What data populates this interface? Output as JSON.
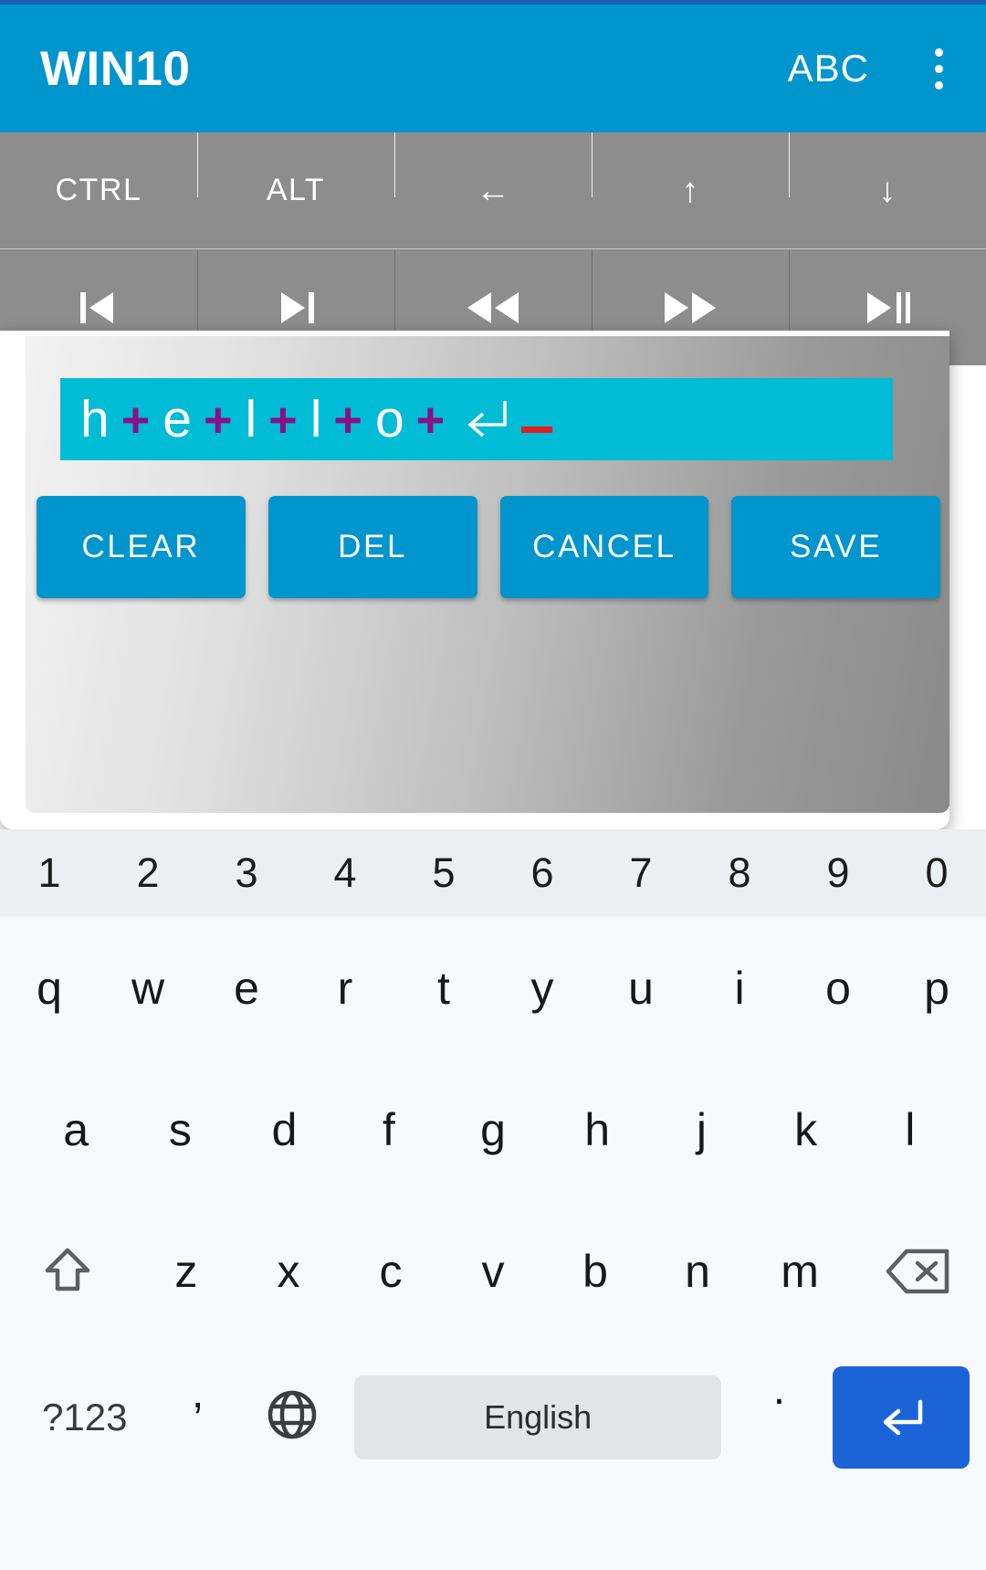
{
  "app": {
    "title": "WIN10",
    "abc_action": "ABC",
    "overflow_icon": "more-vertical-icon",
    "accent_color": "#0195cd",
    "status_bar_color": "#1b5fb0"
  },
  "toolbar": {
    "row1": [
      {
        "label": "CTRL",
        "icon": null,
        "name": "ctrl-key"
      },
      {
        "label": "ALT",
        "icon": null,
        "name": "alt-key"
      },
      {
        "label": "←",
        "icon": "arrow-left-icon",
        "name": "arrow-left-key"
      },
      {
        "label": "↑",
        "icon": "arrow-up-icon",
        "name": "arrow-up-key"
      },
      {
        "label": "↓",
        "icon": "arrow-down-icon",
        "name": "arrow-down-key"
      }
    ],
    "row2": [
      {
        "label": "",
        "icon": "skip-previous-icon",
        "name": "previous-track-key"
      },
      {
        "label": "",
        "icon": "skip-next-icon",
        "name": "next-track-key"
      },
      {
        "label": "",
        "icon": "rewind-icon",
        "name": "rewind-key"
      },
      {
        "label": "",
        "icon": "fast-forward-icon",
        "name": "fast-forward-key"
      },
      {
        "label": "",
        "icon": "play-pause-icon",
        "name": "play-pause-key"
      }
    ]
  },
  "dialog": {
    "field": {
      "background_color": "#00bcd4",
      "caret_color": "#e02020",
      "key_color": "#ffffff",
      "separator_color": "#8a0f8a",
      "sequence": [
        {
          "type": "key",
          "text": "h"
        },
        {
          "type": "sep",
          "text": "+"
        },
        {
          "type": "key",
          "text": "e"
        },
        {
          "type": "sep",
          "text": "+"
        },
        {
          "type": "key",
          "text": "l"
        },
        {
          "type": "sep",
          "text": "+"
        },
        {
          "type": "key",
          "text": "l"
        },
        {
          "type": "sep",
          "text": "+"
        },
        {
          "type": "key",
          "text": "o"
        },
        {
          "type": "sep",
          "text": "+"
        },
        {
          "type": "enter",
          "text": "↵"
        }
      ]
    },
    "buttons": [
      {
        "label": "CLEAR",
        "name": "clear-button"
      },
      {
        "label": "DEL",
        "name": "del-button"
      },
      {
        "label": "CANCEL",
        "name": "cancel-button"
      },
      {
        "label": "SAVE",
        "name": "save-button"
      }
    ]
  },
  "keyboard": {
    "numbers": [
      "1",
      "2",
      "3",
      "4",
      "5",
      "6",
      "7",
      "8",
      "9",
      "0"
    ],
    "row_qwerty": [
      "q",
      "w",
      "e",
      "r",
      "t",
      "y",
      "u",
      "i",
      "o",
      "p"
    ],
    "row_asdf": [
      "a",
      "s",
      "d",
      "f",
      "g",
      "h",
      "j",
      "k",
      "l"
    ],
    "row_zxcv": [
      "z",
      "x",
      "c",
      "v",
      "b",
      "n",
      "m"
    ],
    "shift_icon": "shift-icon",
    "backspace_icon": "backspace-icon",
    "bottom": {
      "symbols_label": "?123",
      "comma_label": ",",
      "globe_icon": "globe-icon",
      "space_label": "English",
      "period_label": ".",
      "enter_icon": "enter-icon",
      "enter_color": "#1b64d8"
    }
  }
}
